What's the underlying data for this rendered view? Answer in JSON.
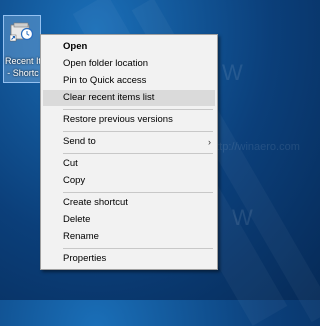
{
  "desktop": {
    "icon_label_line1": "Recent It",
    "icon_label_line2": "- Shortc",
    "watermark_text": "http://winaero.com",
    "watermark_mark": "W"
  },
  "context_menu": {
    "items": [
      {
        "label": "Open",
        "bold": true
      },
      {
        "label": "Open folder location"
      },
      {
        "label": "Pin to Quick access"
      },
      {
        "label": "Clear recent items list",
        "highlighted": true
      },
      {
        "label": "Restore previous versions"
      },
      {
        "label": "Send to",
        "submenu_arrow": "›"
      },
      {
        "label": "Cut"
      },
      {
        "label": "Copy"
      },
      {
        "label": "Create shortcut"
      },
      {
        "label": "Delete"
      },
      {
        "label": "Rename"
      },
      {
        "label": "Properties"
      }
    ]
  }
}
